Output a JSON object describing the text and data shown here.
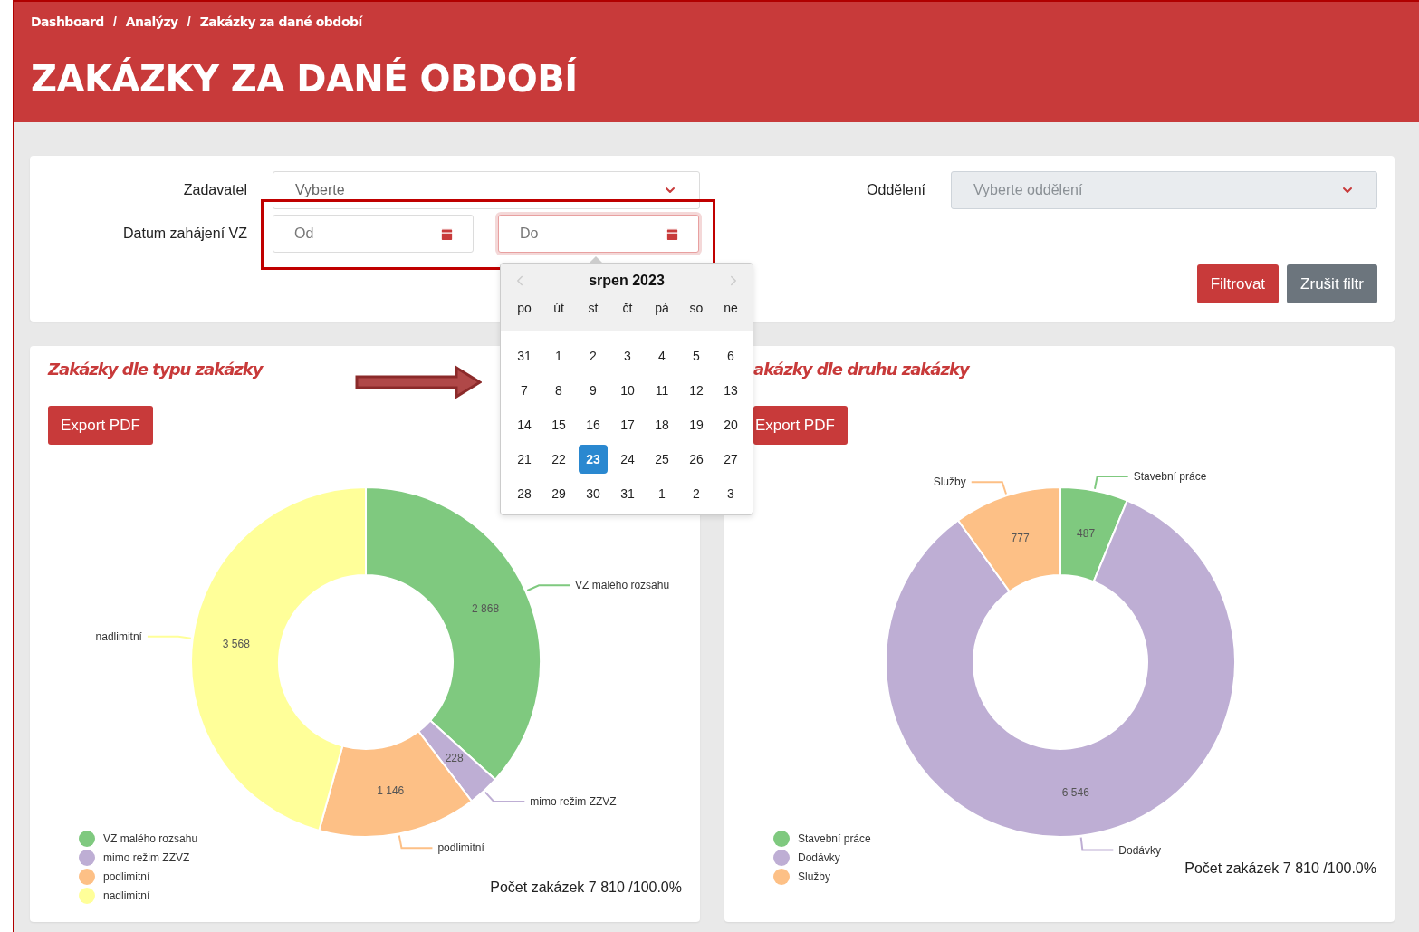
{
  "breadcrumb": {
    "separator": "/",
    "items": [
      "Dashboard",
      "Analýzy",
      "Zakázky za dané období"
    ]
  },
  "page_title": "ZAKÁZKY ZA DANÉ OBDOBÍ",
  "filters": {
    "selects": [
      {
        "label": "Zadavatel",
        "placeholder": "Vyberte",
        "disabled": false
      },
      {
        "label": "Oddělení",
        "placeholder": "Vyberte oddělení",
        "disabled": true
      }
    ],
    "date": {
      "label": "Datum zahájení VZ",
      "inputs": [
        {
          "placeholder": "Od",
          "focused": false
        },
        {
          "placeholder": "Do",
          "focused": true
        }
      ]
    },
    "buttons": [
      {
        "label": "Filtrovat",
        "kind": "primary"
      },
      {
        "label": "Zrušit filtr",
        "kind": "secondary"
      }
    ]
  },
  "datepicker": {
    "month": "srpen 2023",
    "weekdays": [
      "po",
      "út",
      "st",
      "čt",
      "pá",
      "so",
      "ne"
    ],
    "weeks": [
      [
        {
          "label": "31",
          "selected": false
        },
        {
          "label": "1",
          "selected": false
        },
        {
          "label": "2",
          "selected": false
        },
        {
          "label": "3",
          "selected": false
        },
        {
          "label": "4",
          "selected": false
        },
        {
          "label": "5",
          "selected": false
        },
        {
          "label": "6",
          "selected": false
        }
      ],
      [
        {
          "label": "7",
          "selected": false
        },
        {
          "label": "8",
          "selected": false
        },
        {
          "label": "9",
          "selected": false
        },
        {
          "label": "10",
          "selected": false
        },
        {
          "label": "11",
          "selected": false
        },
        {
          "label": "12",
          "selected": false
        },
        {
          "label": "13",
          "selected": false
        }
      ],
      [
        {
          "label": "14",
          "selected": false
        },
        {
          "label": "15",
          "selected": false
        },
        {
          "label": "16",
          "selected": false
        },
        {
          "label": "17",
          "selected": false
        },
        {
          "label": "18",
          "selected": false
        },
        {
          "label": "19",
          "selected": false
        },
        {
          "label": "20",
          "selected": false
        }
      ],
      [
        {
          "label": "21",
          "selected": false
        },
        {
          "label": "22",
          "selected": false
        },
        {
          "label": "23",
          "selected": true
        },
        {
          "label": "24",
          "selected": false
        },
        {
          "label": "25",
          "selected": false
        },
        {
          "label": "26",
          "selected": false
        },
        {
          "label": "27",
          "selected": false
        }
      ],
      [
        {
          "label": "28",
          "selected": false
        },
        {
          "label": "29",
          "selected": false
        },
        {
          "label": "30",
          "selected": false
        },
        {
          "label": "31",
          "selected": false
        },
        {
          "label": "1",
          "selected": false
        },
        {
          "label": "2",
          "selected": false
        },
        {
          "label": "3",
          "selected": false
        }
      ]
    ]
  },
  "charts": [
    {
      "title": "Zakázky dle typu zakázky",
      "export_button": "Export PDF",
      "chart_data": {
        "type": "donut",
        "categories": [
          "VZ malého rozsahu",
          "mimo režim ZZVZ",
          "podlimitní",
          "nadlimitní"
        ],
        "values": [
          2868,
          228,
          1146,
          3568
        ],
        "value_labels": [
          "2 868",
          "228",
          "1 146",
          "3 568"
        ]
      },
      "legend": [
        {
          "label": "VZ malého rozsahu",
          "color": "#7fc97f"
        },
        {
          "label": "mimo režim ZZVZ",
          "color": "#beaed4"
        },
        {
          "label": "podlimitní",
          "color": "#fdc086"
        },
        {
          "label": "nadlimitní",
          "color": "#ffff99"
        }
      ],
      "total": "Počet zakázek 7 810 /100.0%"
    },
    {
      "title": "akázky dle druhu zakázky",
      "export_button": "Export PDF",
      "chart_data": {
        "type": "donut",
        "categories": [
          "Stavební práce",
          "Dodávky",
          "Služby"
        ],
        "values": [
          487,
          6546,
          777
        ],
        "value_labels": [
          "487",
          "6 546",
          "777"
        ]
      },
      "legend": [
        {
          "label": "Stavební práce",
          "color": "#7fc97f"
        },
        {
          "label": "Dodávky",
          "color": "#beaed4"
        },
        {
          "label": "Služby",
          "color": "#fdc086"
        }
      ],
      "total": "Počet zakázek 7 810 /100.0%"
    }
  ]
}
